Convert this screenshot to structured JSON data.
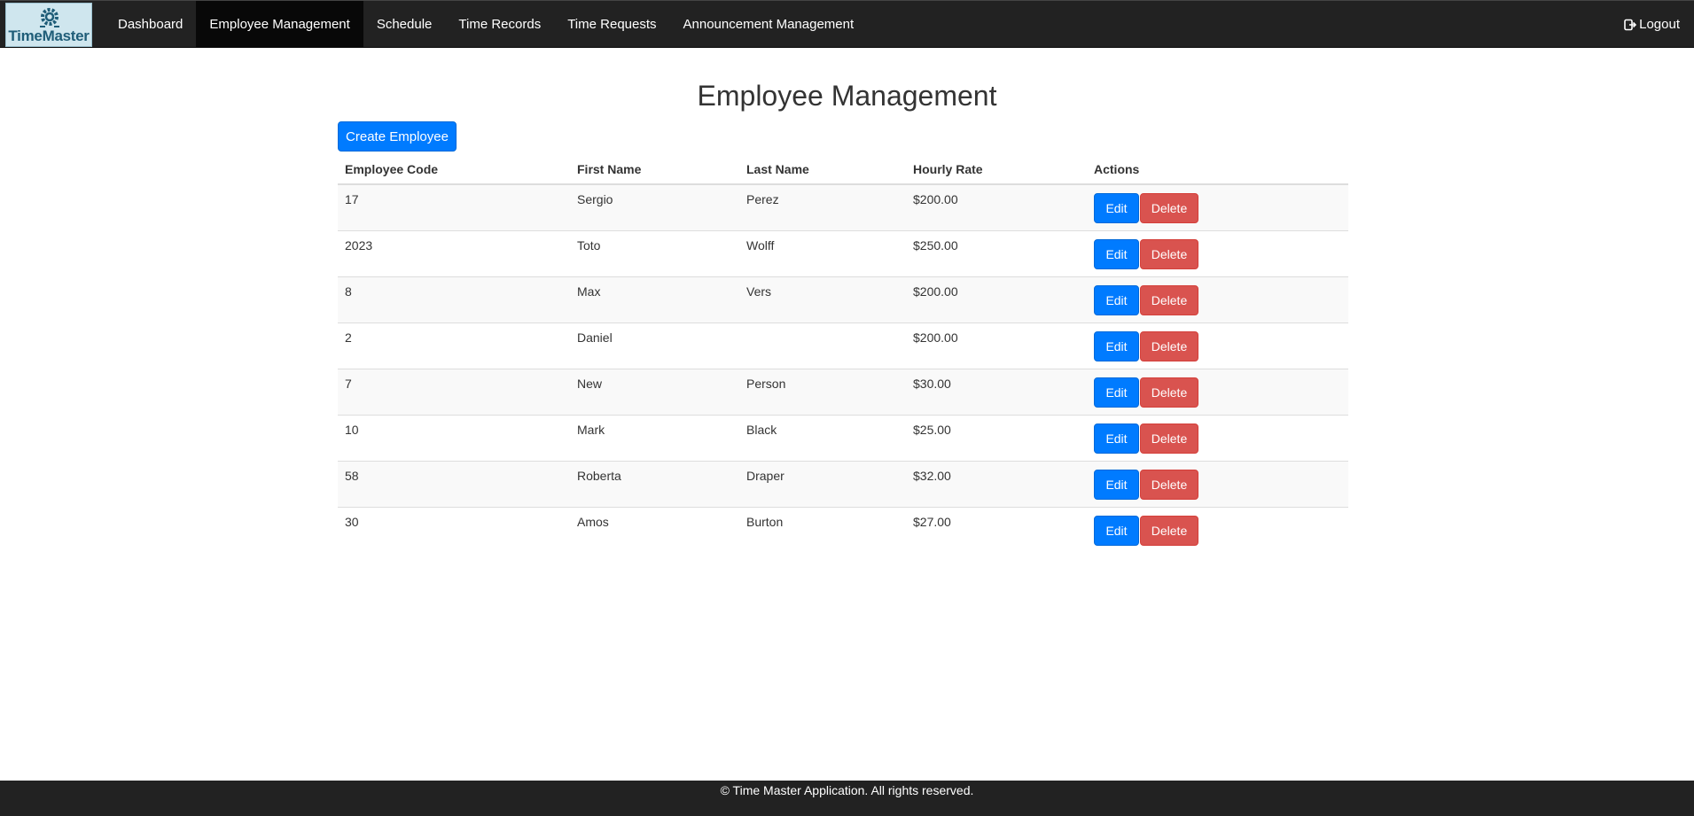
{
  "brand": {
    "name": "TimeMaster",
    "icon": "gear-icon"
  },
  "nav": {
    "items": [
      {
        "label": "Dashboard",
        "active": false
      },
      {
        "label": "Employee Management",
        "active": true
      },
      {
        "label": "Schedule",
        "active": false
      },
      {
        "label": "Time Records",
        "active": false
      },
      {
        "label": "Time Requests",
        "active": false
      },
      {
        "label": "Announcement Management",
        "active": false
      }
    ],
    "logout_label": "Logout",
    "logout_icon": "logout-icon"
  },
  "main": {
    "title": "Employee Management",
    "create_label": "Create Employee",
    "columns": [
      "Employee Code",
      "First Name",
      "Last Name",
      "Hourly Rate",
      "Actions"
    ],
    "edit_label": "Edit",
    "delete_label": "Delete",
    "rows": [
      {
        "code": "17",
        "first": "Sergio",
        "last": "Perez",
        "rate": "$200.00"
      },
      {
        "code": "2023",
        "first": "Toto",
        "last": "Wolff",
        "rate": "$250.00"
      },
      {
        "code": "8",
        "first": "Max",
        "last": "Vers",
        "rate": "$200.00"
      },
      {
        "code": "2",
        "first": "Daniel",
        "last": "",
        "rate": "$200.00"
      },
      {
        "code": "7",
        "first": "New",
        "last": "Person",
        "rate": "$30.00"
      },
      {
        "code": "10",
        "first": "Mark",
        "last": "Black",
        "rate": "$25.00"
      },
      {
        "code": "58",
        "first": "Roberta",
        "last": "Draper",
        "rate": "$32.00"
      },
      {
        "code": "30",
        "first": "Amos",
        "last": "Burton",
        "rate": "$27.00"
      }
    ]
  },
  "colors": {
    "navbar": "#222222",
    "primary": "#007bff",
    "danger": "#d9534f"
  },
  "footer": {
    "text": "© Time Master Application. All rights reserved."
  }
}
